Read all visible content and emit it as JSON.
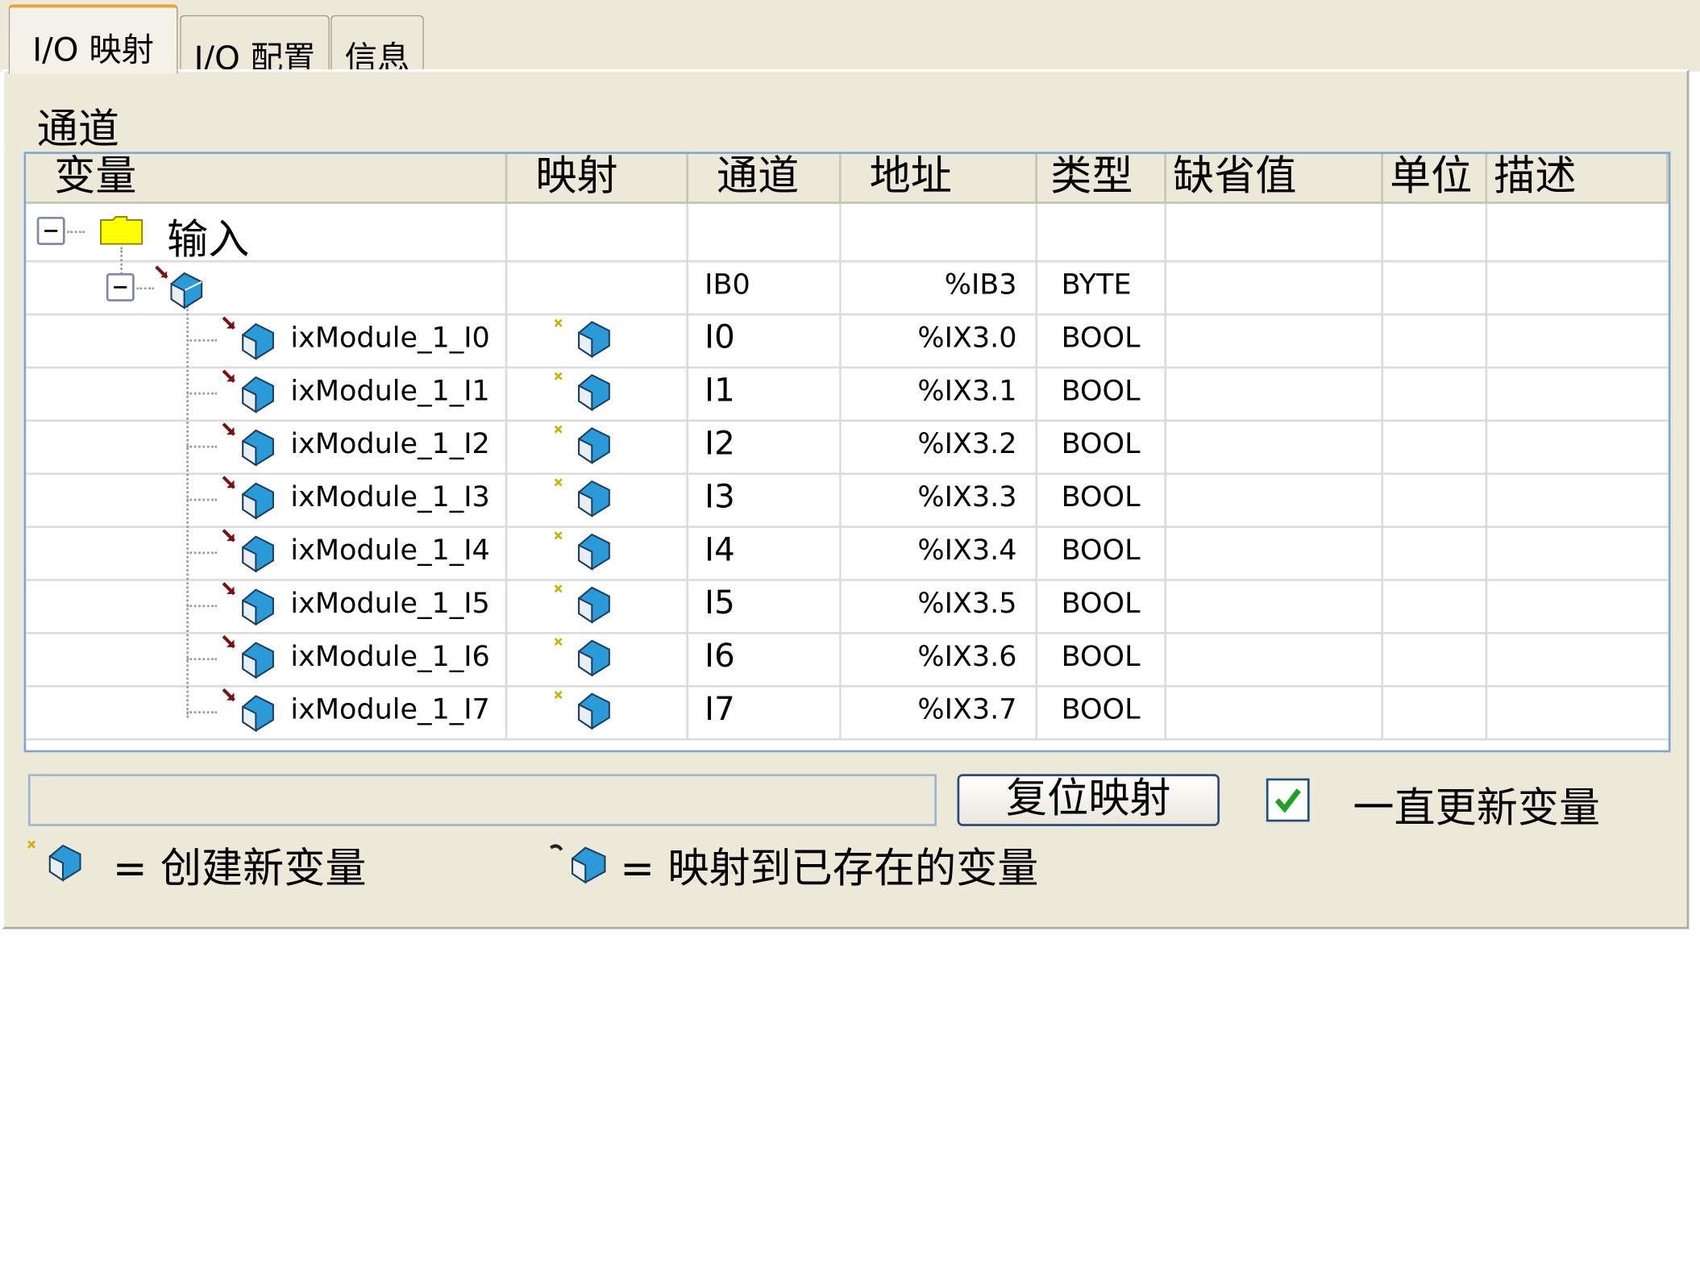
{
  "tabs": [
    {
      "label": "I/O 映射",
      "active": true
    },
    {
      "label": "I/O 配置",
      "active": false
    },
    {
      "label": "信息",
      "active": false
    }
  ],
  "section_label": "通道",
  "columns": [
    "变量",
    "映射",
    "通道",
    "地址",
    "类型",
    "缺省值",
    "单位",
    "描述"
  ],
  "tree": {
    "root_label": "输入",
    "group": {
      "channel": "IB0",
      "address": "%IB3",
      "type": "BYTE"
    },
    "rows": [
      {
        "variable": "ixModule_1_I0",
        "channel": "I0",
        "address": "%IX3.0",
        "type": "BOOL"
      },
      {
        "variable": "ixModule_1_I1",
        "channel": "I1",
        "address": "%IX3.1",
        "type": "BOOL"
      },
      {
        "variable": "ixModule_1_I2",
        "channel": "I2",
        "address": "%IX3.2",
        "type": "BOOL"
      },
      {
        "variable": "ixModule_1_I3",
        "channel": "I3",
        "address": "%IX3.3",
        "type": "BOOL"
      },
      {
        "variable": "ixModule_1_I4",
        "channel": "I4",
        "address": "%IX3.4",
        "type": "BOOL"
      },
      {
        "variable": "ixModule_1_I5",
        "channel": "I5",
        "address": "%IX3.5",
        "type": "BOOL"
      },
      {
        "variable": "ixModule_1_I6",
        "channel": "I6",
        "address": "%IX3.6",
        "type": "BOOL"
      },
      {
        "variable": "ixModule_1_I7",
        "channel": "I7",
        "address": "%IX3.7",
        "type": "BOOL"
      }
    ]
  },
  "reset_button": "复位映射",
  "always_update": {
    "label": "一直更新变量",
    "checked": true
  },
  "legend": {
    "new_variable": "= 创建新变量",
    "existing_variable": "= 映射到已存在的变量"
  },
  "colors": {
    "panel_bg": "#ece9d8",
    "grid_border": "#7ea6d0",
    "active_tab_accent": "#f0a030",
    "checkmark": "#21a121"
  }
}
